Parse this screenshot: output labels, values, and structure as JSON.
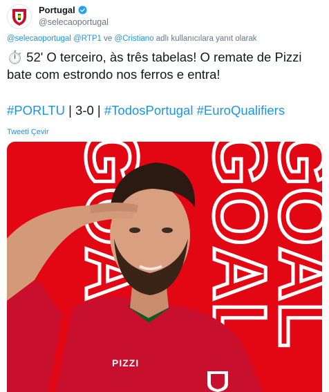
{
  "tweet": {
    "display_name": "Portugal",
    "handle": "@selecaoportugal",
    "reply_to": {
      "handle_1": "@selecaoportugal",
      "handle_2": "@RTP1",
      "conjunction": "ve",
      "handle_3": "@Cristiano",
      "suffix": "adlı kullanıcılara yanıt olarak"
    },
    "text": "⏱️ 52' O terceiro, às três tabelas! O remate de Pizzi bate com estrondo nos ferros e entra!",
    "hashtag_1": "#PORLTU",
    "score": " | 3-0 | ",
    "hashtag_2": "#TodosPortugal",
    "hashtag_3": "#EuroQualifiers",
    "translate_label": "Tweeti Çevir"
  },
  "media": {
    "word_column_1": "GOAL",
    "word_column_2": "GOAL",
    "word_column_3": "GOAL",
    "shirt_name": "PIZZI",
    "background_color": "#e30613"
  },
  "icons": {
    "avatar": "fpf-crest-icon",
    "verified": "verified-badge-icon",
    "timer": "stopwatch-icon"
  }
}
